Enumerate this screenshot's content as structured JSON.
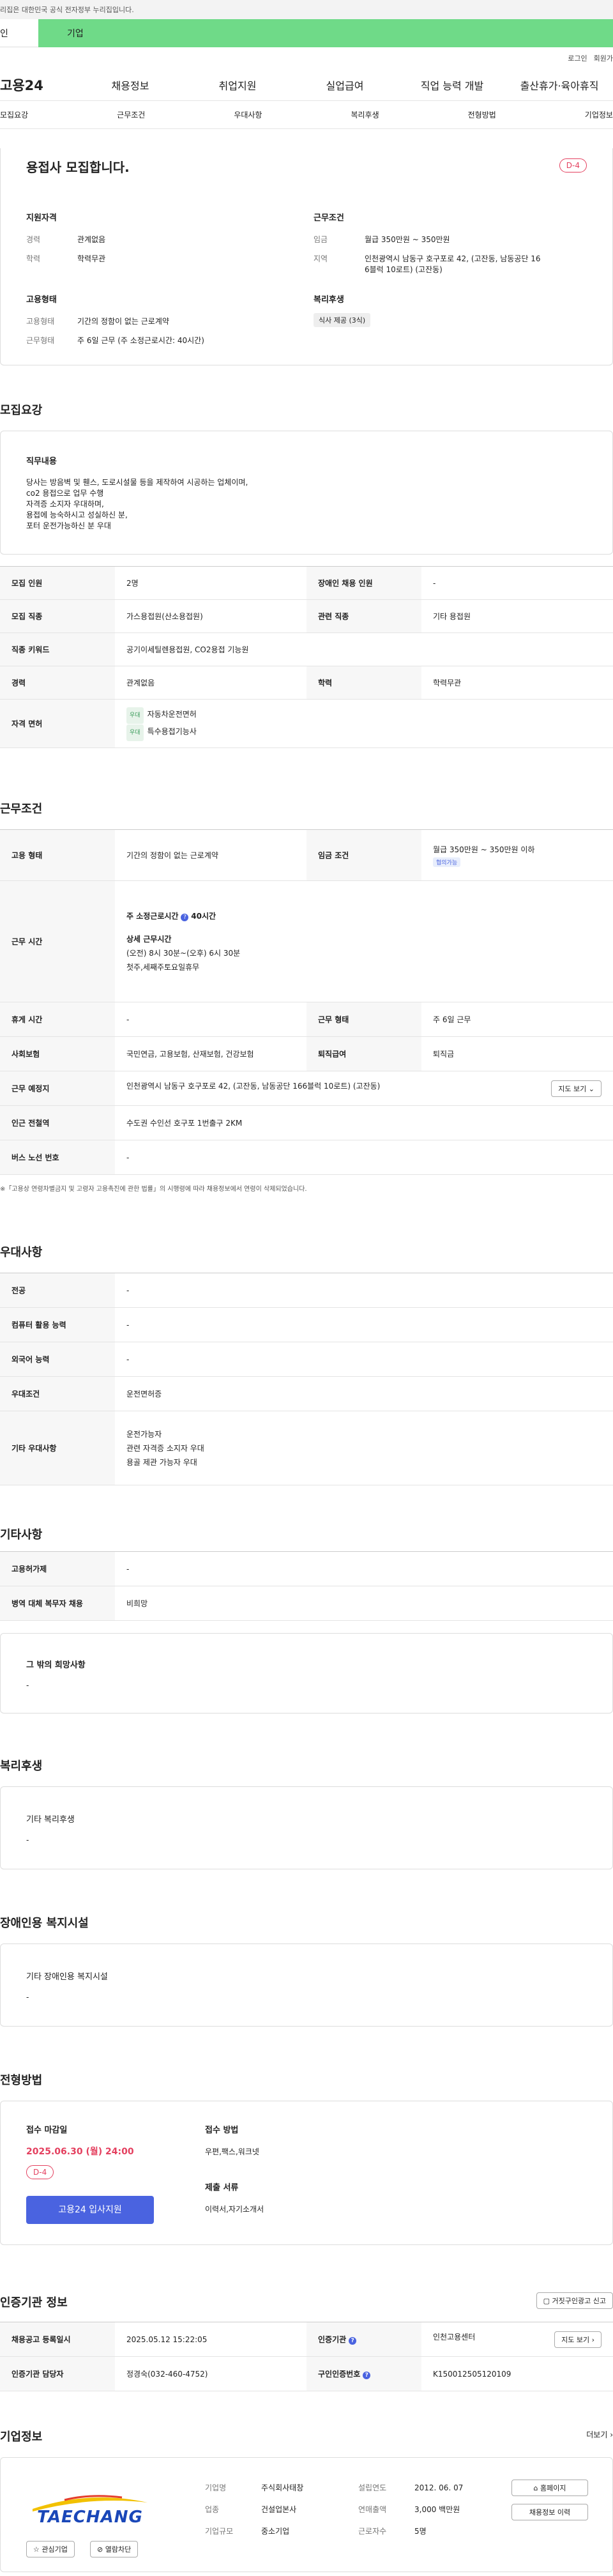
{
  "gov_notice": "리집은 대한민국 공식 전자정부 누리집입니다.",
  "tabs": {
    "person": "인",
    "business": "기업"
  },
  "util": {
    "login": "로그인",
    "join": "회원가"
  },
  "gnb": {
    "logo": "고용24",
    "items": [
      "채용정보",
      "취업지원",
      "실업급여",
      "직업 능력 개발",
      "출산휴가·육아휴직"
    ]
  },
  "subnav": [
    "모집요강",
    "근무조건",
    "우대사항",
    "복리후생",
    "전형방법",
    "기업정보"
  ],
  "summary": {
    "title": "용접사 모집합니다.",
    "dday": "D-4",
    "qual_title": "지원자격",
    "career_lbl": "경력",
    "career": "관계없음",
    "edu_lbl": "학력",
    "edu": "학력무관",
    "cond_title": "근무조건",
    "wage_lbl": "임금",
    "wage": "월급 350만원 ~ 350만원",
    "loc_lbl": "지역",
    "loc1": "인천광역시 남동구 호구포로 42, (고잔동, 남동공단 16",
    "loc2": "6블럭 10로트) (고잔동)",
    "emp_title": "고용형태",
    "emptype_lbl": "고용형태",
    "emptype": "기간의 정함이 없는 근로계약",
    "worktype_lbl": "근무형태",
    "worktype": "주 6일 근무 (주 소정근로시간: 40시간)",
    "welfare_title": "복리후생",
    "welfare_chip": "식사 제공 (3식)"
  },
  "recruit": {
    "title": "모집요강",
    "duty_title": "직무내용",
    "duty": [
      "당사는 방음벽 및 휀스, 도로시설물 등을 제작하여 시공하는 업체이며,",
      "co2 용접으로 업무 수행",
      "자격증 소지자 우대하며,",
      "용접에 능숙하시고 성실하신 분,",
      "포터 운전가능하신 분 우대"
    ],
    "rows": [
      [
        "모집 인원",
        "2명",
        "장애인 채용 인원",
        "-"
      ],
      [
        "모집 직종",
        "가스용접원(산소용접원)",
        "관련 직종",
        "기타 용접원"
      ],
      [
        "직종 키워드",
        "공기이세틸렌용접원, CO2용접 기능원"
      ],
      [
        "경력",
        "관계없음",
        "학력",
        "학력무관"
      ]
    ],
    "license_lbl": "자격 면허",
    "licenses": [
      {
        "chip": "우대",
        "name": "자동차운전면허"
      },
      {
        "chip": "우대",
        "name": "특수용접기능사"
      }
    ]
  },
  "conditions": {
    "title": "근무조건",
    "emptype_lbl": "고용 형태",
    "emptype": "기간의 정함이 없는 근로계약",
    "wage_lbl": "임금 조건",
    "wage": "월급 350만원 ~ 350만원 이하",
    "wage_chip": "협의가능",
    "hours_lbl": "근무 시간",
    "hours_main": "주 소정근로시간",
    "hours_val": "40시간",
    "hours_detail_title": "상세 근무시간",
    "hours_detail1": "(오전) 8시 30분~(오후) 6시 30분",
    "hours_detail2": "첫주,세째주토요일휴무",
    "rest_lbl": "휴게 시간",
    "rest": "-",
    "worktype_lbl": "근무 형태",
    "worktype": "주 6일 근무",
    "ins_lbl": "사회보험",
    "ins": "국민연금, 고용보험, 산재보험, 건강보험",
    "retire_lbl": "퇴직급여",
    "retire": "퇴직금",
    "place_lbl": "근무 예정지",
    "place": "인천광역시 남동구 호구포로 42, (고잔동, 남동공단 166블럭 10로트) (고잔동)",
    "map_btn": "지도 보기",
    "subway_lbl": "인근 전철역",
    "subway": "수도권 수인선 호구포 1번출구 2KM",
    "bus_lbl": "버스 노선 번호",
    "bus": "-",
    "note": "※「고용상 연령차별금지 및 고령자 고용촉진에 관한 법률」의 시행령에 따라 채용정보에서 연령이 삭제되었습니다."
  },
  "prefer": {
    "title": "우대사항",
    "rows": [
      [
        "전공",
        "-"
      ],
      [
        "컴퓨터 활용 능력",
        "-"
      ],
      [
        "외국어 능력",
        "-"
      ],
      [
        "우대조건",
        "운전면허증"
      ]
    ],
    "etc_lbl": "기타 우대사항",
    "etc": [
      "운전가능자",
      "관련 자격증 소지자 우대",
      "용골 제관 가능자 우대"
    ]
  },
  "other": {
    "title": "기타사항",
    "rows": [
      [
        "고용허가제",
        "-"
      ],
      [
        "병역 대체 복무자 채용",
        "비희망"
      ]
    ],
    "wish_title": "그 밖의 희망사항",
    "wish": "-"
  },
  "welfare": {
    "title": "복리후생",
    "box_title": "기타 복리후생",
    "box_val": "-"
  },
  "disabled": {
    "title": "장애인용 복지시설",
    "box_title": "기타 장애인용 복지시설",
    "box_val": "-"
  },
  "process": {
    "title": "전형방법",
    "deadline_lbl": "접수 마감일",
    "deadline": "2025.06.30 (월) 24:00",
    "dday": "D-4",
    "apply_btn": "고용24 입사지원",
    "method_lbl": "접수 방법",
    "method": "우편,팩스,워크넷",
    "docs_lbl": "제출 서류",
    "docs": "이력서,자기소개서"
  },
  "cert": {
    "title": "인증기관 정보",
    "report_btn": "거짓구인광고 신고",
    "rows": [
      [
        "채용공고 등록일시",
        "2025.05.12 15:22:05",
        "인증기관",
        "인천고용센터"
      ],
      [
        "인증기관 담당자",
        "정경숙(032-460-4752)",
        "구인인증번호",
        "K150012505120109"
      ]
    ],
    "map_btn": "지도 보기"
  },
  "company": {
    "title": "기업정보",
    "more": "더보기",
    "logo_text": "TAECHANG",
    "fields": [
      [
        "기업명",
        "주식회사태창",
        "설립연도",
        "2012. 06. 07"
      ],
      [
        "업종",
        "건설업본사",
        "연매출액",
        "3,000 백만원"
      ],
      [
        "기업규모",
        "중소기업",
        "근로자수",
        "5명"
      ]
    ],
    "btn_home": "홈페이지",
    "btn_jobs": "채용정보 이력",
    "btn_fav": "관심기업",
    "btn_block": "열람차단"
  }
}
